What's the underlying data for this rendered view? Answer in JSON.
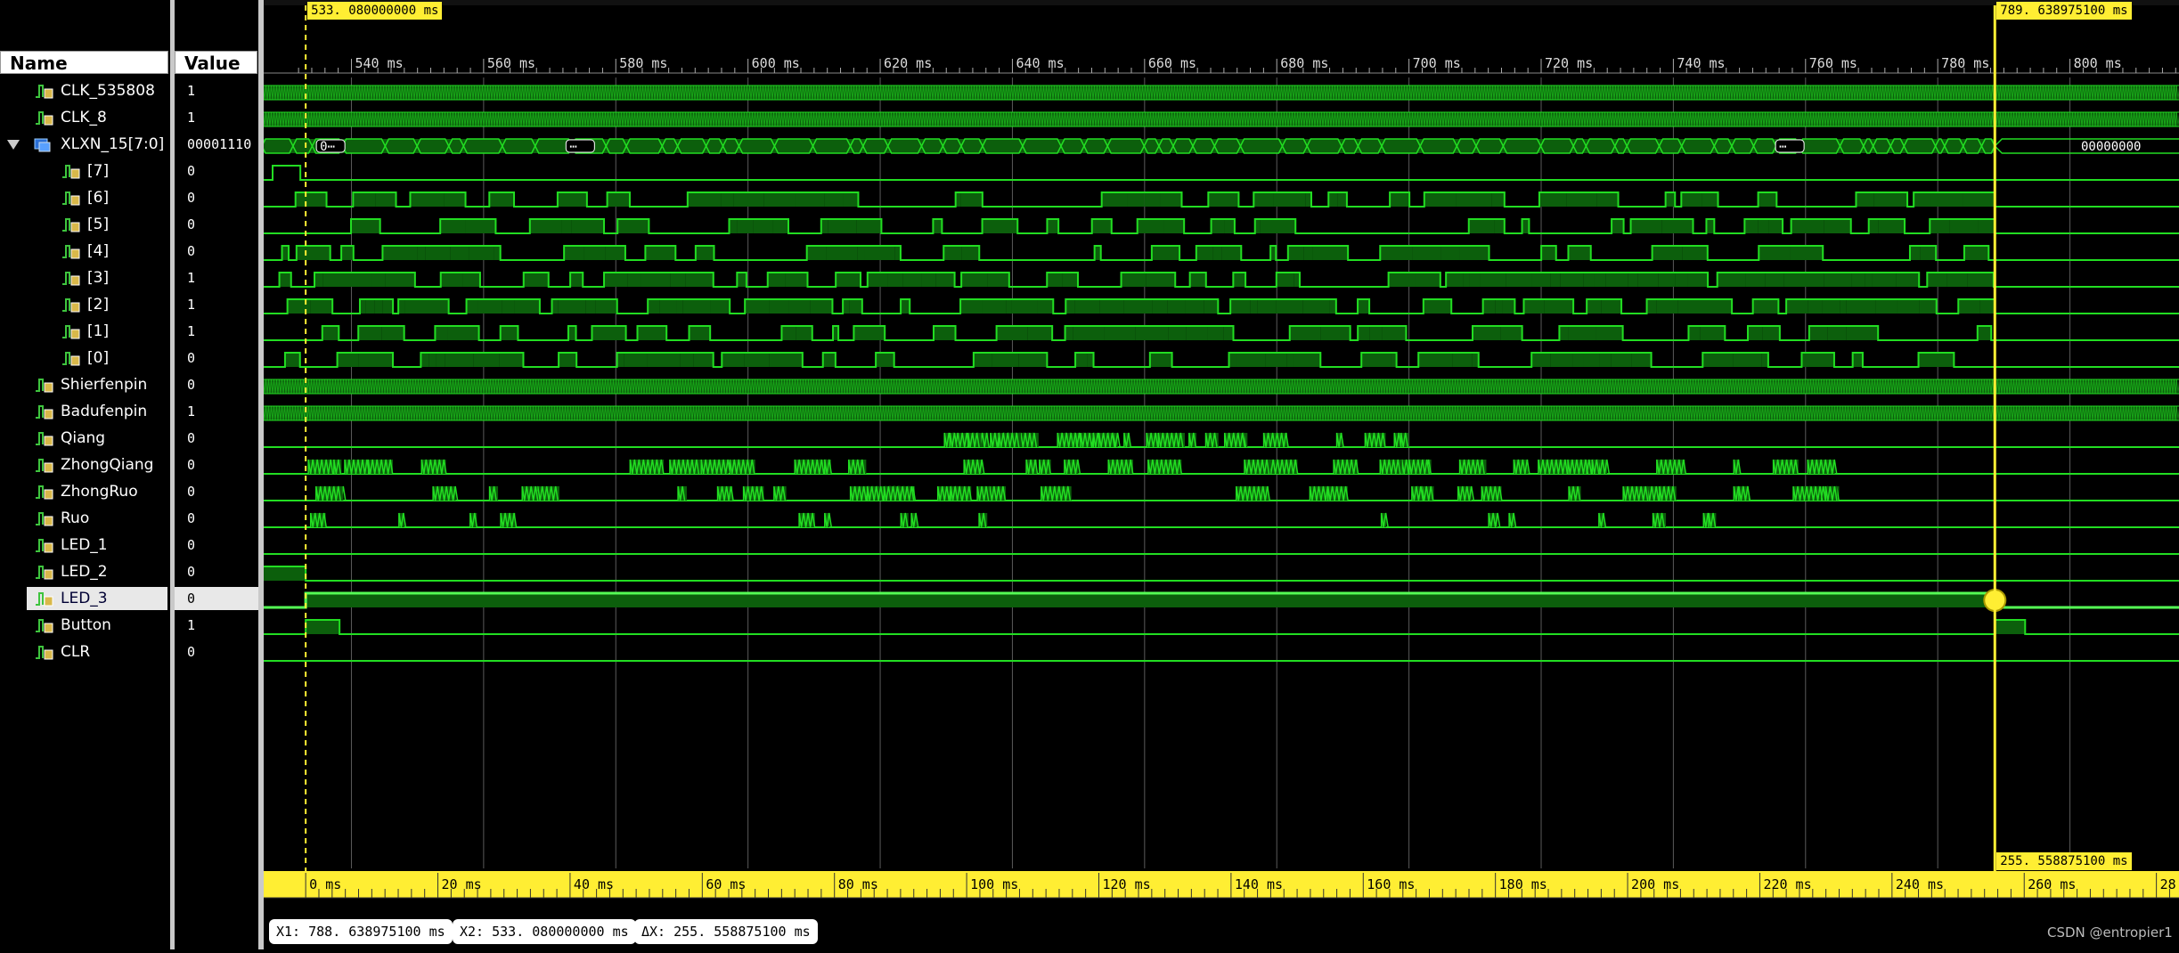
{
  "panel": {
    "name_header": "Name",
    "value_header": "Value"
  },
  "colors": {
    "wave": "#22dd22",
    "wave_fill": "#0c5f0c",
    "cursor": "#ffee33",
    "background": "#000000"
  },
  "signals": [
    {
      "name": "CLK_535808",
      "value": "1",
      "child": false,
      "kind": "clock_fast",
      "icon": "signal-icon"
    },
    {
      "name": "CLK_8",
      "value": "1",
      "child": false,
      "kind": "clock_fast",
      "icon": "signal-icon"
    },
    {
      "name": "XLXN_15[7:0]",
      "value": "00001110",
      "child": false,
      "kind": "bus",
      "icon": "bus-icon",
      "expanded": true,
      "bus_labels": [
        "0⋯",
        "⋯",
        "⋯",
        "00000000"
      ]
    },
    {
      "name": "[7]",
      "value": "0",
      "child": true,
      "kind": "pulse_start",
      "icon": "signal-icon"
    },
    {
      "name": "[6]",
      "value": "0",
      "child": true,
      "kind": "random",
      "icon": "signal-icon"
    },
    {
      "name": "[5]",
      "value": "0",
      "child": true,
      "kind": "random",
      "icon": "signal-icon"
    },
    {
      "name": "[4]",
      "value": "0",
      "child": true,
      "kind": "random",
      "icon": "signal-icon"
    },
    {
      "name": "[3]",
      "value": "1",
      "child": true,
      "kind": "random_dense",
      "icon": "signal-icon"
    },
    {
      "name": "[2]",
      "value": "1",
      "child": true,
      "kind": "random_dense",
      "icon": "signal-icon"
    },
    {
      "name": "[1]",
      "value": "1",
      "child": true,
      "kind": "random",
      "icon": "signal-icon"
    },
    {
      "name": "[0]",
      "value": "0",
      "child": true,
      "kind": "random",
      "icon": "signal-icon"
    },
    {
      "name": "Shierfenpin",
      "value": "0",
      "child": false,
      "kind": "clock_fast",
      "icon": "signal-icon"
    },
    {
      "name": "Badufenpin",
      "value": "1",
      "child": false,
      "kind": "clock_fast",
      "icon": "signal-icon"
    },
    {
      "name": "Qiang",
      "value": "0",
      "child": false,
      "kind": "bursts_mid",
      "icon": "signal-icon"
    },
    {
      "name": "ZhongQiang",
      "value": "0",
      "child": false,
      "kind": "bursts",
      "icon": "signal-icon"
    },
    {
      "name": "ZhongRuo",
      "value": "0",
      "child": false,
      "kind": "bursts",
      "icon": "signal-icon"
    },
    {
      "name": "Ruo",
      "value": "0",
      "child": false,
      "kind": "bursts_sparse",
      "icon": "signal-icon"
    },
    {
      "name": "LED_1",
      "value": "0",
      "child": false,
      "kind": "low",
      "icon": "signal-icon"
    },
    {
      "name": "LED_2",
      "value": "0",
      "child": false,
      "kind": "led2",
      "icon": "signal-icon"
    },
    {
      "name": "LED_3",
      "value": "0",
      "child": false,
      "kind": "led3",
      "icon": "signal-icon",
      "selected": true
    },
    {
      "name": "Button",
      "value": "1",
      "child": false,
      "kind": "button",
      "icon": "signal-icon"
    },
    {
      "name": "CLR",
      "value": "0",
      "child": false,
      "kind": "low",
      "icon": "signal-icon"
    }
  ],
  "timeline": {
    "top_ticks": [
      "540 ms",
      "560 ms",
      "580 ms",
      "600 ms",
      "620 ms",
      "640 ms",
      "660 ms",
      "680 ms",
      "700 ms",
      "720 ms",
      "740 ms",
      "760 ms",
      "780 ms",
      "800 ms"
    ],
    "bottom_ticks": [
      "0 ms",
      "20 ms",
      "40 ms",
      "60 ms",
      "80 ms",
      "100 ms",
      "120 ms",
      "140 ms",
      "160 ms",
      "180 ms",
      "200 ms",
      "220 ms",
      "240 ms",
      "260 ms",
      "28"
    ],
    "view_start_ms": 530.5,
    "view_end_ms": 816.5,
    "cursor1_ms": 533.08,
    "cursor2_ms": 788.6389
  },
  "cursors": {
    "c1_tag": "533. 080000000 ms",
    "c2_tag": "789. 638975100 ms",
    "delta_tag": "255. 558875100 ms"
  },
  "status": {
    "x1": "X1: 788. 638975100 ms",
    "x2": "X2: 533. 080000000 ms",
    "dx": "ΔX: 255. 558875100 ms"
  },
  "watermark": "CSDN @entropier1"
}
